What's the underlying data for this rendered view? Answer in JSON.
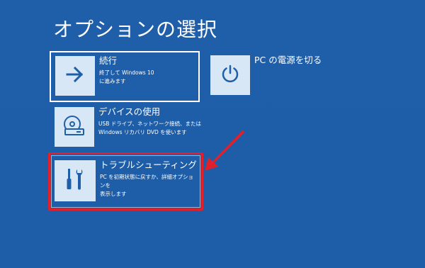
{
  "header": {
    "title": "オプションの選択"
  },
  "options": [
    {
      "id": "continue",
      "label": "続行",
      "description": "終了して Windows 10\nに進みます",
      "icon": "arrow-right-icon"
    },
    {
      "id": "use_device",
      "label": "デバイスの使用",
      "description": "USB ドライブ、ネットワーク接続、または\nWindows リカバリ DVD を使います",
      "icon": "disc-drive-icon"
    },
    {
      "id": "troubleshoot",
      "label": "トラブルシューティング",
      "description": "PC を初期状態に戻すか、詳細オプションを\n表示します",
      "icon": "tools-icon"
    },
    {
      "id": "power_off",
      "label": "PC の電源を切る",
      "description": "",
      "icon": "power-icon"
    }
  ],
  "colors": {
    "background": "#1f5fa9",
    "tile": "#d8e7f6",
    "icon": "#1f5fa9",
    "highlight": "#e0202a",
    "focus_border": "#ffffff"
  }
}
